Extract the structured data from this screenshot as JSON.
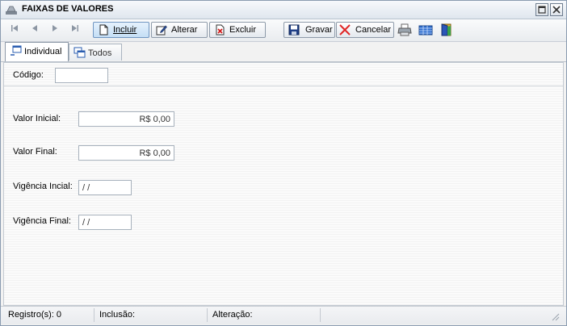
{
  "window": {
    "title": "FAIXAS DE VALORES"
  },
  "toolbar": {
    "incluir": "Incluir",
    "alterar": "Alterar",
    "excluir": "Excluir",
    "gravar": "Gravar",
    "cancelar": "Cancelar"
  },
  "tabs": {
    "individual": "Individual",
    "todos": "Todos"
  },
  "form": {
    "codigo_label": "Código:",
    "codigo_value": "",
    "valor_inicial_label": "Valor Inicial:",
    "valor_inicial_value": "R$ 0,00",
    "valor_final_label": "Valor Final:",
    "valor_final_value": "R$ 0,00",
    "vigencia_inicial_label": "Vigência Incial:",
    "vigencia_inicial_value": "/ /",
    "vigencia_final_label": "Vigência Final:",
    "vigencia_final_value": "/ /"
  },
  "status": {
    "registros": "Registro(s): 0",
    "inclusao": "Inclusão:",
    "alteracao": "Alteração:"
  }
}
